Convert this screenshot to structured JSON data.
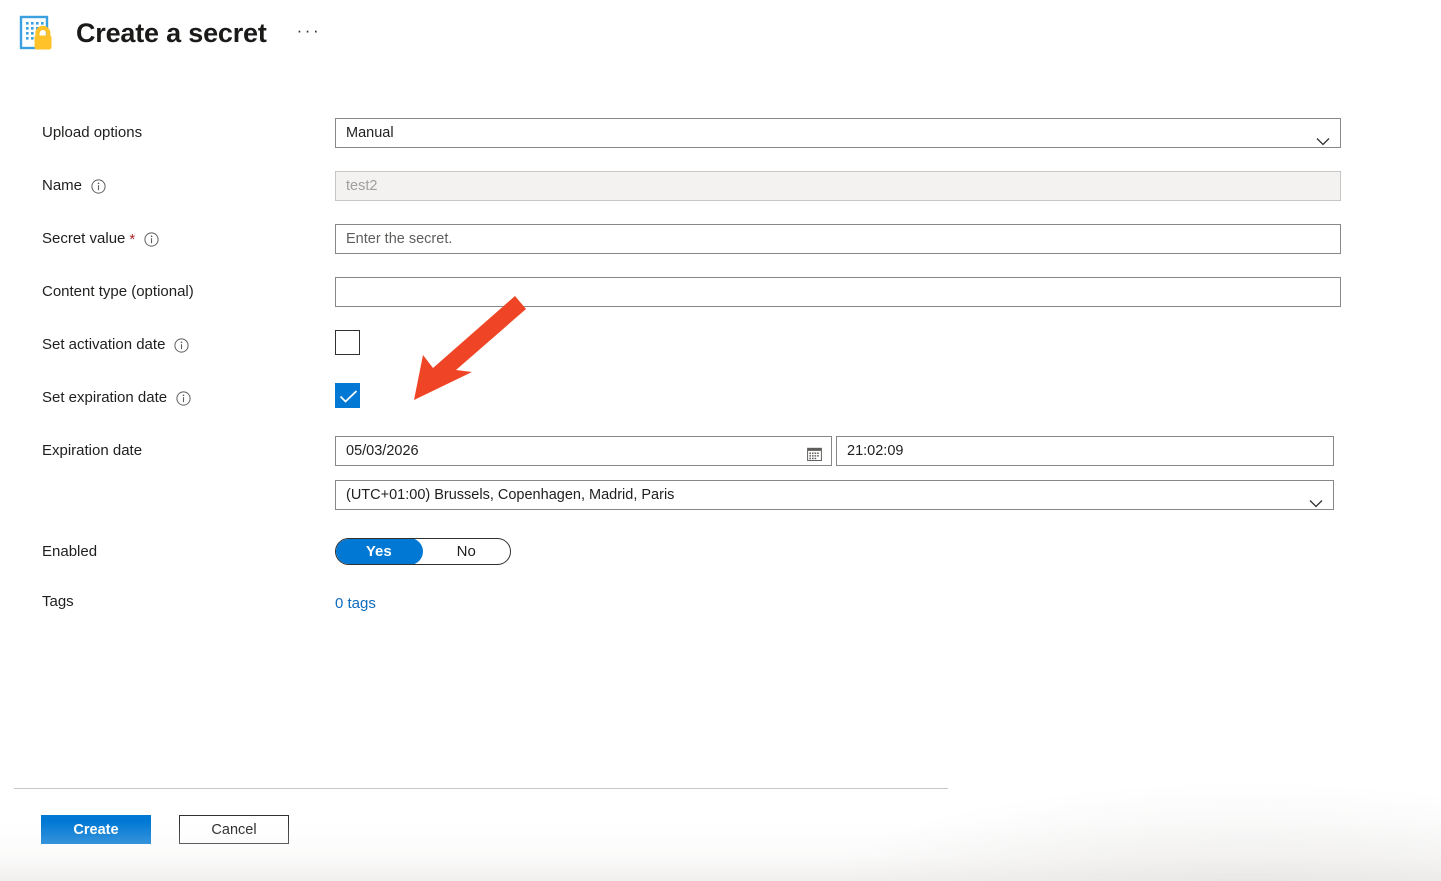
{
  "page": {
    "title": "Create a secret",
    "icon": "secret-key-vault-icon",
    "more_menu": "···",
    "accent_color": "#0078d4",
    "link_color": "#0f6cbd",
    "required_color": "#a4262c",
    "annotation_arrow_color": "#ef4526"
  },
  "form": {
    "upload_options": {
      "label": "Upload options",
      "value": "Manual",
      "chevron": "chevron-down-icon"
    },
    "name": {
      "label": "Name",
      "info": "info-icon",
      "value": "",
      "placeholder": "test2",
      "disabled": true
    },
    "secret_value": {
      "label": "Secret value",
      "required_marker": "*",
      "info": "info-icon",
      "value": "",
      "placeholder": "Enter the secret."
    },
    "content_type": {
      "label": "Content type (optional)",
      "value": "",
      "placeholder": ""
    },
    "set_activation_date": {
      "label": "Set activation date",
      "info": "info-icon",
      "checked": false
    },
    "set_expiration_date": {
      "label": "Set expiration date",
      "info": "info-icon",
      "checked": true
    },
    "expiration_date": {
      "label": "Expiration date",
      "date_value": "05/03/2026",
      "date_icon": "calendar-icon",
      "time_value": "21:02:09",
      "timezone_value": "(UTC+01:00) Brussels, Copenhagen, Madrid, Paris",
      "timezone_chevron": "chevron-down-icon"
    },
    "enabled": {
      "label": "Enabled",
      "yes_label": "Yes",
      "no_label": "No",
      "selected": "Yes"
    },
    "tags": {
      "label": "Tags",
      "link_text": "0 tags"
    }
  },
  "footer": {
    "create_label": "Create",
    "cancel_label": "Cancel"
  }
}
